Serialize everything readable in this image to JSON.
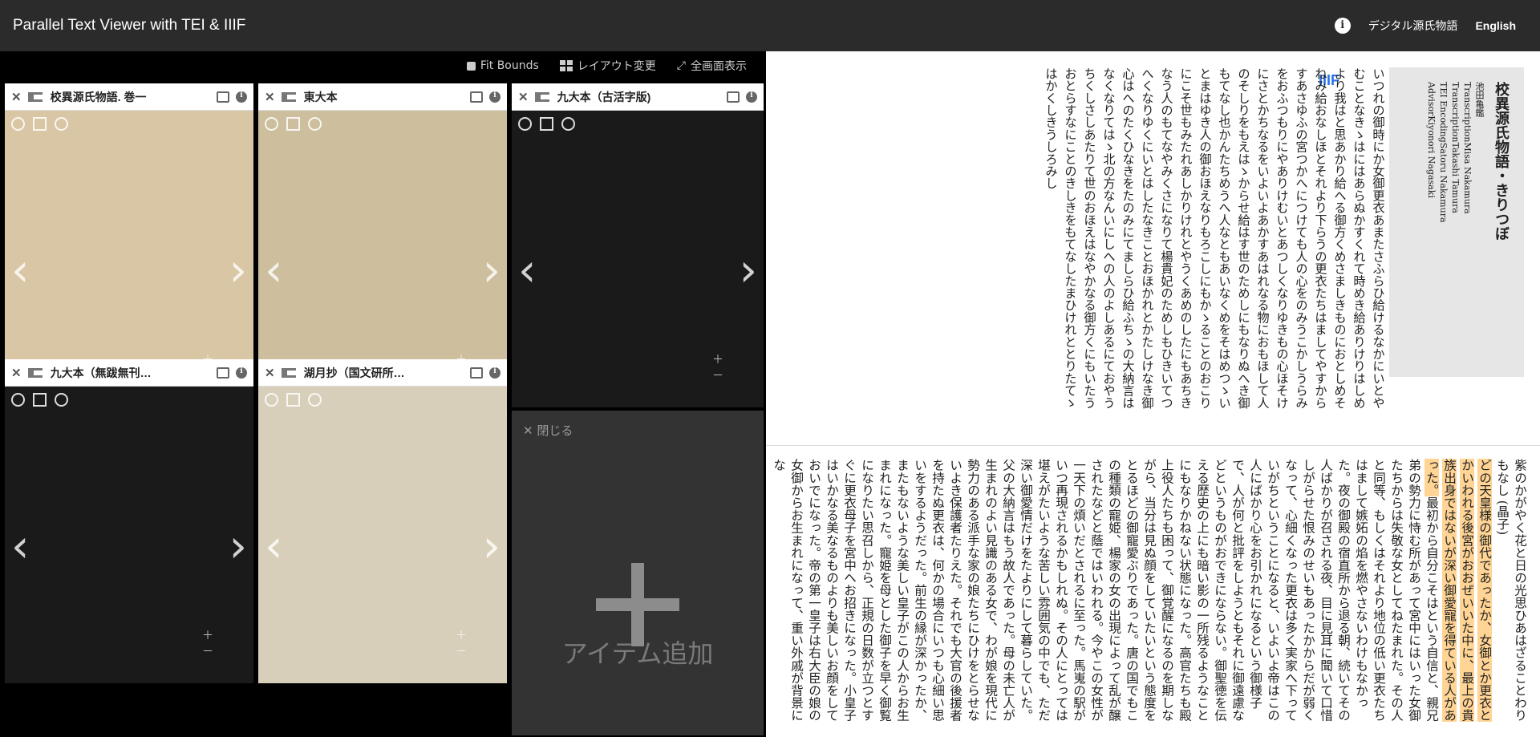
{
  "topbar": {
    "title": "Parallel Text Viewer with TEI & IIIF",
    "link": "デジタル源氏物語",
    "lang": "English"
  },
  "mirador": {
    "toolbar": {
      "fit": "Fit Bounds",
      "layout": "レイアウト変更",
      "fullscreen": "全画面表示"
    },
    "windows": [
      {
        "title": "校異源氏物語. 巻一",
        "bg": "#d9c6a4"
      },
      {
        "title": "東大本",
        "bg": "#cdbf9d"
      },
      {
        "title": "九大本（古活字版)",
        "bg": "#1a1a1a"
      },
      {
        "title": "九大本（無跋無刊…",
        "bg": "#1a1a1a"
      },
      {
        "title": "湖月抄（国文研所…",
        "bg": "#d8cfba"
      }
    ],
    "add": {
      "close": "閉じる",
      "label": "アイテム追加"
    }
  },
  "info": {
    "title": "校異源氏物語・きりつぼ",
    "lines": [
      "池田亀鑑",
      "TranscriptionMisa Nakamura",
      "TranscriptionTakashi Tamura",
      "TEI EncodingSatoru Nakamura",
      "AdvisorKiyonori Nagasaki"
    ]
  },
  "tei_text": "いつれの御時にか女御更衣あまたさふらひ給けるなかにいとやむことなきゝはにはあらぬかすくれて時めき給ありけりはしめより我はと思あかり給へる御方くめさましきものにおとしめそねみ給おなしほとそれより下らうの更衣たちはましてやすからすあさゆふの宮つかへにつけても人の心をのみうこかしうらみをおふつもりにやありけむいとあつしくなりゆきもの心ほそけにさとかちなるをいよいよあかすあはれなる物におもほして人のそしりをもえはゝからせ給はす世のためしにもなりぬへき御もてなし也かんたちめうへ人なともあいなくめをそはめつゝいとまはゆき人の御おほえなりもろこしにもかゝることのおこりにこそ世もみたれあしかりけれとやうくあめのしたにもあちきなう人のもてなやみくさになりて楊貴妃のためしもひきいてつへくなりゆくにいとはしたなきことおほかれとかたしけなき御心はへのたくひなきをたのみにてましらひ給ふちゝの大納言はなくなりてはゝ北の方なんいにしへの人のよしあるにておやうちくしさしあたりて世のおほえはなやかなる御方くにもいたうおとらすなにことのきしきをもてなしたまひけれととりたてゝはかくしきうしろみし",
  "modern": {
    "intro": "紫のかがやく花と日の光思ひあはざることわりもなし",
    "author": "(晶子)",
    "highlight": "どの天皇様の御代であったか、女御とか更衣とかいわれる後宮がおおぜいいた中に、最上の貴族出身ではないが深い御愛寵を得ている人があった。",
    "body": "最初から自分こそはという自信と、親兄弟の勢力に恃む所があって宮中にはいった女御たちからは失敬な女としてねたまれた。その人と同等、もしくはそれより地位の低い更衣たちはまして嫉妬の焰を燃やさないわけもなかった。夜の御殿の宿直所から退る朝、続いてその人ばかりが召される夜、目に見耳に聞いて口惜しがらせた恨みのせいもあったかからだが弱くなって、心細くなった更衣は多く実家へ下っていがちということになると、いよいよ帝はこの人にばかり心をお引かれになるという御様子で、人が何と批評をしようともそれに御遠慮などというものがおできにならない。御聖徳を伝える歴史の上にも暗い影の一所残るようなことにもなりかねない状態になった。高官たちも殿上役人たちも困って、御覚醒になるのを期しながら、当分は見ぬ顔をしていたいという態度をとるほどの御寵愛ぶりであった。唐の国でもこの種類の寵姫、楊家の女の出現によって乱が醸されたなどと蔭ではいわれる。今やこの女性が一天下の煩いだとされるに至った。馬嵬の駅がいつ再現されるかもしれぬ。その人にとっては堪えがたいような苦しい雰囲気の中でも、ただ深い御愛情だけをたよりにして暮らしていた。父の大納言はもう故人であった。母の未亡人が生まれのよい見識のある女で、わが娘を現代に勢力のある派手な家の娘たちにひけをとらせないよき保護者たりえた。それでも大官の後援者を持たぬ更衣は、何かの場合にいつも心細い思いをするようだった。前生の縁が深かったか、またもないような美しい皇子がこの人からお生まれになった。寵姫を母とした御子を早く御覧になりたい思召しから、正規の日数が立つとすぐに更衣母子を宮中へお招きになった。小皇子はいかなる美なるものよりも美しいお顔をしておいでになった。帝の第一皇子は右大臣の娘の女御からお生まれになって、重い外戚が背景にな"
  }
}
